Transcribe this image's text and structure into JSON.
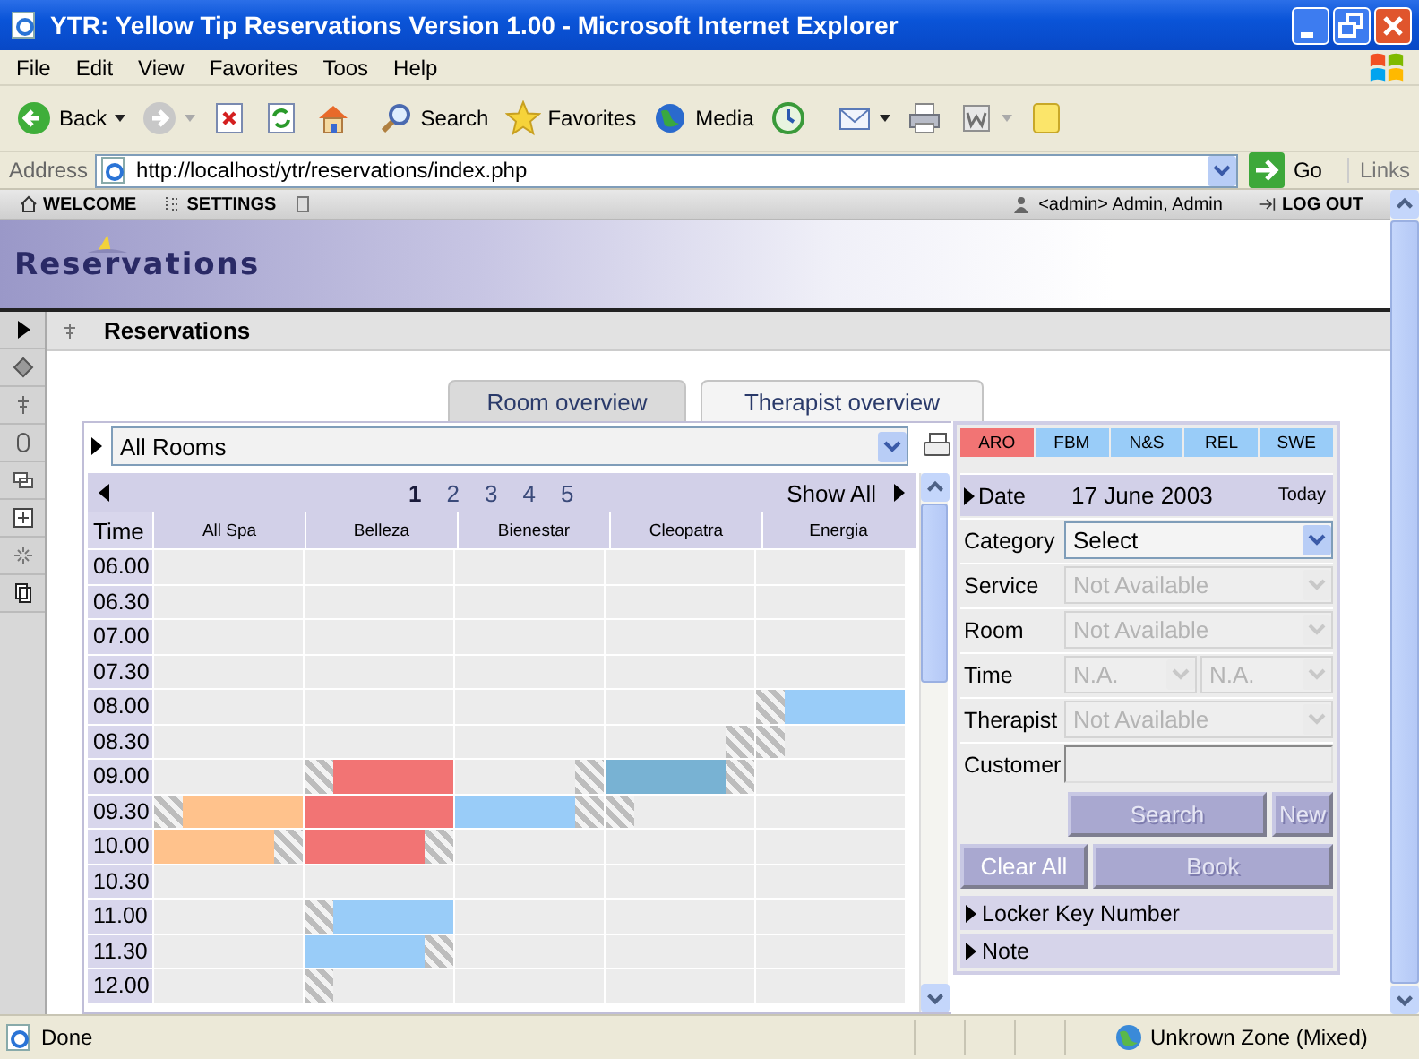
{
  "window": {
    "title": "YTR: Yellow Tip Reservations Version 1.00 - Microsoft Internet Explorer"
  },
  "menu": [
    "File",
    "Edit",
    "View",
    "Favorites",
    "Toos",
    "Help"
  ],
  "toolbar": [
    {
      "kind": "back",
      "label": "Back"
    },
    {
      "kind": "forward"
    },
    {
      "kind": "stop"
    },
    {
      "kind": "refresh"
    },
    {
      "kind": "home"
    },
    {
      "kind": "search",
      "label": "Search"
    },
    {
      "kind": "favorites",
      "label": "Favorites"
    },
    {
      "kind": "media",
      "label": "Media"
    },
    {
      "kind": "history"
    },
    {
      "kind": "mail"
    },
    {
      "kind": "print"
    },
    {
      "kind": "edit"
    },
    {
      "kind": "messenger"
    }
  ],
  "address": {
    "label": "Address",
    "url": "http://localhost/ytr/reservations/index.php",
    "go": "Go",
    "links": "Links"
  },
  "app_bar": {
    "items": [
      "WELCOME",
      "SETTINGS"
    ],
    "user": "<admin> Admin, Admin",
    "logout": "LOG OUT"
  },
  "banner": {
    "logo": "Reservations"
  },
  "page": {
    "title": "Reservations"
  },
  "view_tabs": [
    {
      "label": "Room overview",
      "selected": true
    },
    {
      "label": "Therapist overview",
      "selected": false
    }
  ],
  "room_select": {
    "value": "All Rooms"
  },
  "pages": [
    {
      "label": "1",
      "selected": true
    },
    {
      "label": "2",
      "selected": false
    },
    {
      "label": "3",
      "selected": false
    },
    {
      "label": "4",
      "selected": false
    },
    {
      "label": "5",
      "selected": false
    }
  ],
  "show_all": "Show All",
  "grid": {
    "time_header": "Time",
    "columns": [
      "All Spa",
      "Belleza",
      "Bienestar",
      "Cleopatra",
      "Energia"
    ],
    "rows": [
      {
        "time": "06.00",
        "cells": [
          {
            "kind": "free"
          },
          {
            "kind": "free"
          },
          {
            "kind": "free"
          },
          {
            "kind": "free"
          },
          {
            "kind": "free"
          }
        ]
      },
      {
        "time": "06.30",
        "cells": [
          {
            "kind": "free"
          },
          {
            "kind": "free"
          },
          {
            "kind": "free"
          },
          {
            "kind": "free"
          },
          {
            "kind": "free"
          }
        ]
      },
      {
        "time": "07.00",
        "cells": [
          {
            "kind": "free"
          },
          {
            "kind": "free"
          },
          {
            "kind": "free"
          },
          {
            "kind": "free"
          },
          {
            "kind": "free"
          }
        ]
      },
      {
        "time": "07.30",
        "cells": [
          {
            "kind": "free"
          },
          {
            "kind": "free"
          },
          {
            "kind": "free"
          },
          {
            "kind": "free"
          },
          {
            "kind": "free"
          }
        ]
      },
      {
        "time": "08.00",
        "cells": [
          {
            "kind": "free"
          },
          {
            "kind": "free"
          },
          {
            "kind": "free"
          },
          {
            "kind": "free"
          },
          {
            "kind": "hatch-then-fill",
            "color": "#99ccf8"
          }
        ]
      },
      {
        "time": "08.30",
        "cells": [
          {
            "kind": "free"
          },
          {
            "kind": "free"
          },
          {
            "kind": "free"
          },
          {
            "kind": "hatch-end"
          },
          {
            "kind": "hatch-start"
          }
        ]
      },
      {
        "time": "09.00",
        "cells": [
          {
            "kind": "free"
          },
          {
            "kind": "hatch-then-fill",
            "color": "#f27474"
          },
          {
            "kind": "hatch-end"
          },
          {
            "kind": "fill-then-hatch",
            "color": "#78b2d3"
          },
          {
            "kind": "free"
          }
        ]
      },
      {
        "time": "09.30",
        "cells": [
          {
            "kind": "hatch-then-fill",
            "color": "#ffc28c"
          },
          {
            "kind": "fill",
            "color": "#f27474"
          },
          {
            "kind": "fill-then-hatch",
            "color": "#99ccf8"
          },
          {
            "kind": "hatch-start"
          },
          {
            "kind": "free"
          }
        ]
      },
      {
        "time": "10.00",
        "cells": [
          {
            "kind": "fill-then-hatch",
            "color": "#ffc28c"
          },
          {
            "kind": "fill-then-hatch",
            "color": "#f27474"
          },
          {
            "kind": "free"
          },
          {
            "kind": "free"
          },
          {
            "kind": "free"
          }
        ]
      },
      {
        "time": "10.30",
        "cells": [
          {
            "kind": "free"
          },
          {
            "kind": "free"
          },
          {
            "kind": "free"
          },
          {
            "kind": "free"
          },
          {
            "kind": "free"
          }
        ]
      },
      {
        "time": "11.00",
        "cells": [
          {
            "kind": "free"
          },
          {
            "kind": "hatch-then-fill",
            "color": "#99ccf8"
          },
          {
            "kind": "free"
          },
          {
            "kind": "free"
          },
          {
            "kind": "free"
          }
        ]
      },
      {
        "time": "11.30",
        "cells": [
          {
            "kind": "free"
          },
          {
            "kind": "fill-then-hatch",
            "color": "#99ccf8"
          },
          {
            "kind": "free"
          },
          {
            "kind": "free"
          },
          {
            "kind": "free"
          }
        ]
      },
      {
        "time": "12.00",
        "cells": [
          {
            "kind": "free"
          },
          {
            "kind": "hatch-start"
          },
          {
            "kind": "free"
          },
          {
            "kind": "free"
          },
          {
            "kind": "free"
          }
        ]
      }
    ]
  },
  "categories": [
    {
      "label": "ARO",
      "selected": true
    },
    {
      "label": "FBM",
      "selected": false
    },
    {
      "label": "N&S",
      "selected": false
    },
    {
      "label": "REL",
      "selected": false
    },
    {
      "label": "SWE",
      "selected": false
    }
  ],
  "form": {
    "date_label": "Date",
    "date": "17 June 2003",
    "today": "Today",
    "fields": [
      {
        "kind": "select",
        "label": "Category",
        "values": [
          "Select"
        ],
        "disabled": false
      },
      {
        "kind": "select",
        "label": "Service",
        "values": [
          "Not Available"
        ],
        "disabled": true
      },
      {
        "kind": "select",
        "label": "Room",
        "values": [
          "Not Available"
        ],
        "disabled": true
      },
      {
        "kind": "select",
        "label": "Time",
        "values": [
          "N.A.",
          "N.A."
        ],
        "disabled": true
      },
      {
        "kind": "select",
        "label": "Therapist",
        "values": [
          "Not Available"
        ],
        "disabled": true
      },
      {
        "kind": "text",
        "label": "Customer"
      }
    ],
    "search_buttons": [
      {
        "label": "Search",
        "disabled": true
      },
      {
        "label": "New",
        "disabled": true
      }
    ],
    "action_buttons": [
      {
        "label": "Clear All",
        "disabled": false
      },
      {
        "label": "Book",
        "disabled": true
      }
    ],
    "sections": [
      "Locker Key Number",
      "Note"
    ]
  },
  "status_bar": {
    "text": "Done",
    "zone": "Unkrown Zone (Mixed)"
  }
}
